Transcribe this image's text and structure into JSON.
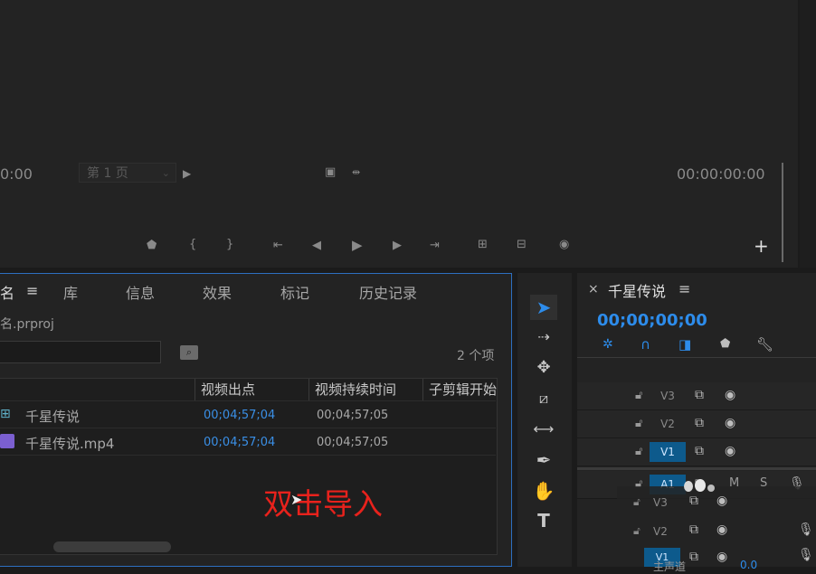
{
  "monitor": {
    "timecode_left": "0:00",
    "page_select": "第 1 页",
    "timecode_right": "00:00:00:00"
  },
  "project": {
    "tabs": [
      "名",
      "库",
      "信息",
      "效果",
      "标记",
      "历史记录"
    ],
    "project_file": "名.prproj",
    "item_count": "2 个项",
    "columns": [
      "视频出点",
      "视频持续时间",
      "子剪辑开始"
    ],
    "rows": [
      {
        "name": "千星传说",
        "video_out": "00;04;57;04",
        "duration": "00;04;57;05"
      },
      {
        "name": "千星传说.mp4",
        "video_out": "00;04;57;04",
        "duration": "00;04;57;05"
      }
    ],
    "overlay_text": "双击导入"
  },
  "timeline": {
    "close": "×",
    "title": "千星传说",
    "timecode": "00;00;00;00",
    "tracks": [
      "V3",
      "V2",
      "V1",
      "A1"
    ],
    "audio_ms": [
      "M",
      "S"
    ],
    "ghost_tracks": [
      "V3",
      "V2",
      "V1"
    ],
    "footer_text": "主声道",
    "footer_value": "0.0"
  },
  "icons": {
    "menu": "hamburger-icon",
    "search": "search-bin-icon",
    "lock": "lock-icon",
    "eye": "eye-icon",
    "mic": "microphone-icon",
    "selection_tool": "arrow-icon"
  },
  "colors": {
    "accent_blue": "#2d8ceb",
    "overlay_red": "#e8221c",
    "selected_track": "#0d5a8c"
  }
}
